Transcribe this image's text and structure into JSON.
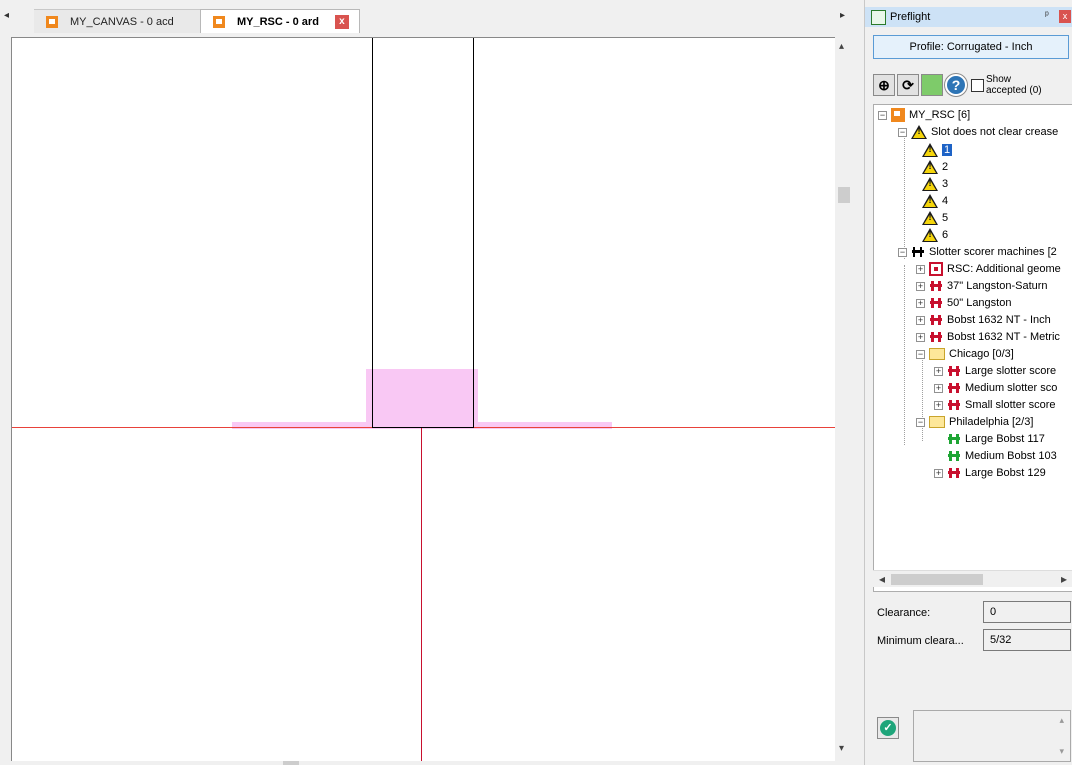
{
  "tabs": [
    {
      "label": "MY_CANVAS - 0 acd",
      "active": false
    },
    {
      "label": "MY_RSC - 0 ard",
      "active": true
    }
  ],
  "tab_close_glyph": "x",
  "scroll_glyphs": {
    "left": "◂",
    "right": "▸",
    "up": "▴",
    "down": "▾"
  },
  "panel": {
    "title": "Preflight",
    "pin_glyph": "ᵖ",
    "close_glyph": "x",
    "profile_button": "Profile: Corrugated - Inch",
    "show_accepted_label": "Show accepted (0)",
    "tree": {
      "root": "MY_RSC [6]",
      "warning_group": "Slot does not clear crease",
      "warnings": [
        "1",
        "2",
        "3",
        "4",
        "5",
        "6"
      ],
      "selected_warning": "1",
      "machines_group": "Slotter scorer machines [2",
      "machines": [
        {
          "label": "RSC: Additional geome",
          "icon": "red-square-icon"
        },
        {
          "label": "37\" Langston-Saturn",
          "icon": "red-machine-icon"
        },
        {
          "label": "50\" Langston",
          "icon": "red-machine-icon"
        },
        {
          "label": "Bobst 1632 NT - Inch",
          "icon": "red-machine-icon"
        },
        {
          "label": "Bobst 1632 NT - Metric",
          "icon": "red-machine-icon"
        }
      ],
      "chicago": {
        "label": "Chicago [0/3]",
        "items": [
          "Large slotter score",
          "Medium slotter sco",
          "Small slotter score"
        ]
      },
      "philadelphia": {
        "label": "Philadelphia [2/3]",
        "items": [
          {
            "label": "Large Bobst 117",
            "status": "green"
          },
          {
            "label": "Medium Bobst 103",
            "status": "green"
          },
          {
            "label": "Large Bobst 129",
            "status": "red"
          }
        ]
      }
    },
    "fields": {
      "clearance_label": "Clearance:",
      "clearance_value": "0",
      "min_clearance_label": "Minimum cleara...",
      "min_clearance_value": "5/32"
    },
    "ok_glyph": "✓"
  },
  "colors": {
    "crosshair": "#e8423a",
    "highlight": "#f9c8f4",
    "accent": "#1e63c6"
  }
}
